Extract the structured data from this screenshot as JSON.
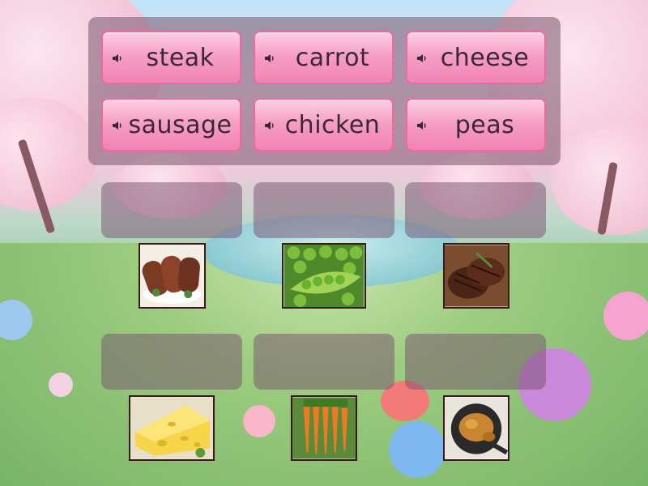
{
  "word_bank": {
    "tiles": [
      {
        "label": "steak"
      },
      {
        "label": "carrot"
      },
      {
        "label": "cheese"
      },
      {
        "label": "sausage"
      },
      {
        "label": "chicken"
      },
      {
        "label": "peas"
      }
    ]
  },
  "drop_zones": [
    {
      "image": "sausage-image"
    },
    {
      "image": "peas-image"
    },
    {
      "image": "steak-image"
    },
    {
      "image": "cheese-image"
    },
    {
      "image": "carrot-image"
    },
    {
      "image": "chicken-image"
    }
  ],
  "colors": {
    "tile_fill": "#f59cc2",
    "tile_border": "#f067a6",
    "panel": "#78586e"
  }
}
